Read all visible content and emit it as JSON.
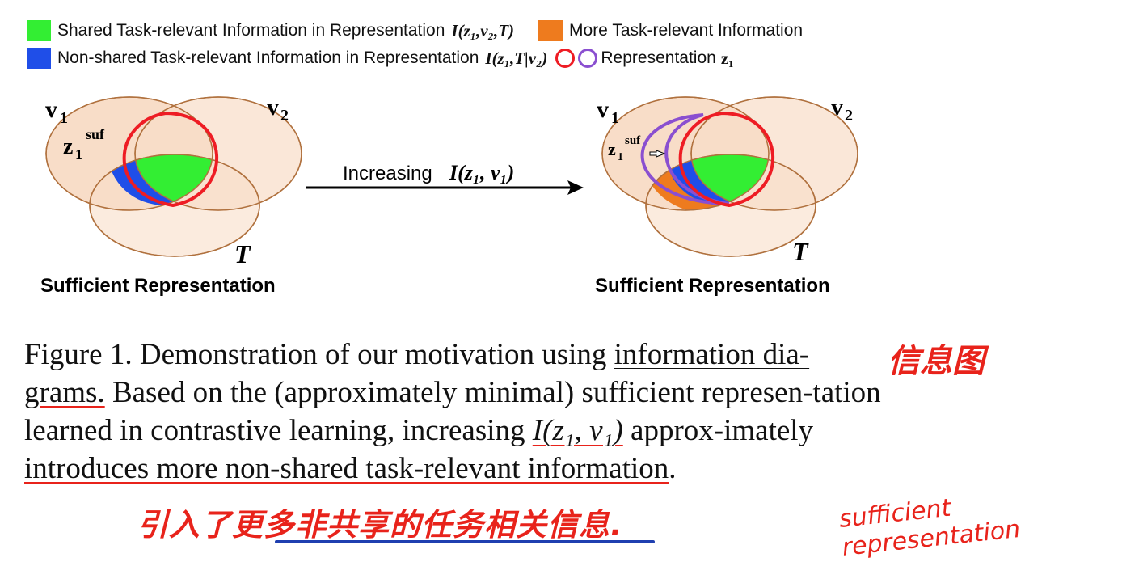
{
  "legend": {
    "shared_label": "Shared Task-relevant Information in Representation",
    "shared_math": "I(z₁,v₂,T)",
    "more_label": "More Task-relevant Information",
    "nonshared_label": "Non-shared Task-relevant Information in Representation",
    "nonshared_math": "I(z₁,T|v₂)",
    "repr_label": "Representation",
    "repr_math": "z₁",
    "colors": {
      "shared": "#33ee33",
      "more": "#ee7b1e",
      "nonshared": "#1f4ee8",
      "ring_red": "#ee1c24",
      "ring_purple": "#8a4fd0",
      "circle_fill": "#f8ddc8",
      "circle_stroke": "#b0713e"
    }
  },
  "diagram_left": {
    "v1": "v",
    "v1_sub": "1",
    "v2": "v",
    "v2_sub": "2",
    "z": "z",
    "z_sub": "1",
    "z_sup": "suf",
    "t": "T",
    "label": "Sufficient Representation"
  },
  "arrow": {
    "text": "Increasing",
    "math": "I(z₁, v₁)"
  },
  "diagram_right": {
    "v1": "v",
    "v1_sub": "1",
    "v2": "v",
    "v2_sub": "2",
    "z": "z",
    "z_sub": "1",
    "z_sup": "suf",
    "t": "T",
    "label": "Sufficient Representation"
  },
  "caption": {
    "p1": "Figure 1. Demonstration of our motivation using ",
    "u1": "information dia-",
    "u2": "grams.",
    "p2": " Based on the (approximately minimal) sufficient represen-tation learned in contrastive learning, increasing ",
    "math": "I(z₁, v₁)",
    "p3": " approx-imately ",
    "u3": "introduces more non-shared task-relevant information",
    "p4": "."
  },
  "annotations": {
    "note1": "信息图",
    "note2": "引入了更多非共享的任务相关信息.",
    "note3": "sufficient representation"
  }
}
